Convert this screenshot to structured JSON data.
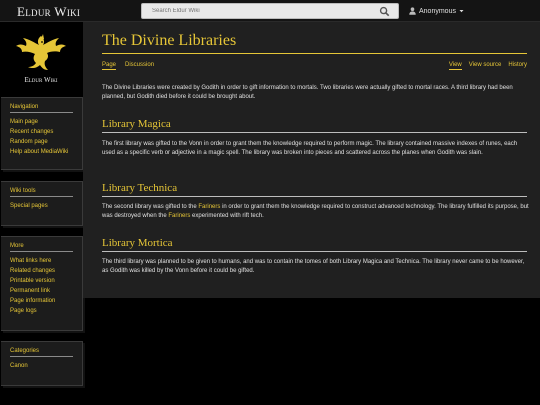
{
  "site": {
    "name": "Eldur Wiki",
    "logo_text": "Eldur Wiki"
  },
  "search": {
    "placeholder": "Search Eldur Wiki"
  },
  "user": {
    "name": "Anonymous"
  },
  "colors": {
    "accent": "#e6c637",
    "background": "#000000",
    "content_bg": "#202020",
    "topbar_bg": "#141414"
  },
  "sidebar": {
    "navigation": {
      "title": "Navigation",
      "items": [
        "Main page",
        "Recent changes",
        "Random page",
        "Help about MediaWiki"
      ]
    },
    "wiki_tools": {
      "title": "Wiki tools",
      "items": [
        "Special pages"
      ]
    },
    "more": {
      "title": "More",
      "items": [
        "What links here",
        "Related changes",
        "Printable version",
        "Permanent link",
        "Page information",
        "Page logs"
      ]
    },
    "categories": {
      "title": "Categories",
      "items": [
        "Canon"
      ]
    }
  },
  "page": {
    "title": "The Divine Libraries",
    "tabs_left": [
      "Page",
      "Discussion"
    ],
    "tabs_right": [
      "View",
      "View source",
      "History"
    ],
    "intro": "The Divine Libraries were created by Godith in order to gift information to mortals. Two libraries were actually gifted to mortal races. A third library had been planned, but Godith died before it could be brought about.",
    "sections": [
      {
        "heading": "Library Magica",
        "text": "The first library was gifted to the Vonn in order to grant them the knowledge required to perform magic. The library contained massive indexes of runes, each used as a specific verb or adjective in a magic spell. The library was broken into pieces and scattered across the planes when Godith was slain."
      },
      {
        "heading": "Library Technica",
        "text_a": "The second library was gifted to the ",
        "link_a": "Fariners",
        "text_b": " in order to grant them the knowledge required to construct advanced technology. The library fulfilled its purpose, but was destroyed when the ",
        "link_b": "Fariners",
        "text_c": " experimented with rift tech."
      },
      {
        "heading": "Library Mortica",
        "text": "The third library was planned to be given to humans, and was to contain the tomes of both Library Magica and Technica. The library never came to be however, as Godith was killed by the Vonn before it could be gifted."
      }
    ]
  }
}
